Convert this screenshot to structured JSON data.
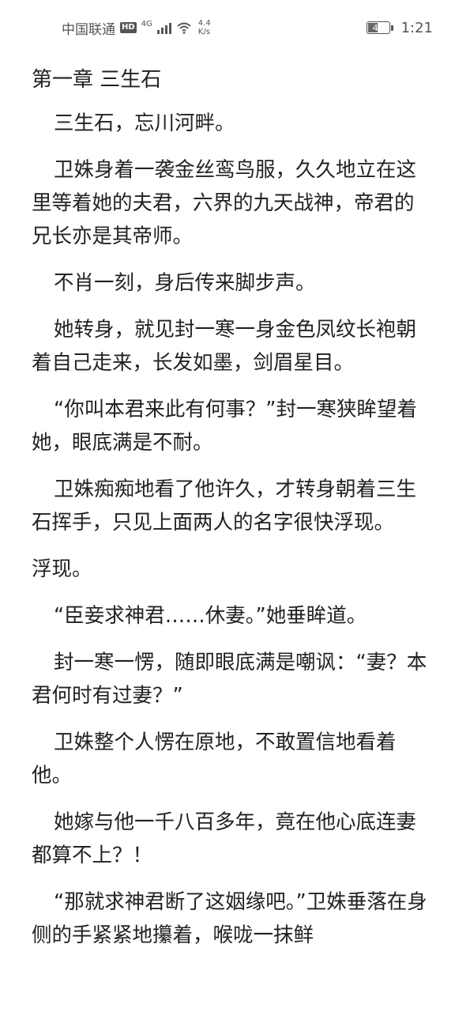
{
  "status_bar": {
    "carrier": "中国联通",
    "hd_badge": "HD",
    "network_type": "4G",
    "net_speed_value": "4.4",
    "net_speed_unit": "K/s",
    "battery_level": "47",
    "battery_fraction": 0.47,
    "time": "1:21"
  },
  "chapter": {
    "title": "第一章 三生石",
    "paragraphs": [
      {
        "text": "三生石，忘川河畔。",
        "indent": true
      },
      {
        "text": "卫姝身着一袭金丝鸾鸟服，久久地立在这里等着她的夫君，六界的九天战神，帝君的兄长亦是其帝师。",
        "indent": true
      },
      {
        "text": "不肖一刻，身后传来脚步声。",
        "indent": true
      },
      {
        "text": "她转身，就见封一寒一身金色凤纹长袍朝着自己走来，长发如墨，剑眉星目。",
        "indent": true
      },
      {
        "text": "“你叫本君来此有何事？”封一寒狭眸望着她，眼底满是不耐。",
        "indent": true
      },
      {
        "text": "卫姝痴痴地看了他许久，才转身朝着三生石挥手，只见上面两人的名字很快浮现。",
        "indent": true
      },
      {
        "text": "浮现。",
        "indent": false
      },
      {
        "text": "“臣妾求神君……休妻。”她垂眸道。",
        "indent": true
      },
      {
        "text": "封一寒一愣，随即眼底满是嘲讽：“妻？本君何时有过妻？”",
        "indent": true
      },
      {
        "text": "卫姝整个人愣在原地，不敢置信地看着他。",
        "indent": true
      },
      {
        "text": "她嫁与他一千八百多年，竟在他心底连妻都算不上？！",
        "indent": true
      },
      {
        "text": "“那就求神君断了这姻缘吧。”卫姝垂落在身侧的手紧紧地攥着，喉咙一抹鲜",
        "indent": true
      }
    ]
  }
}
